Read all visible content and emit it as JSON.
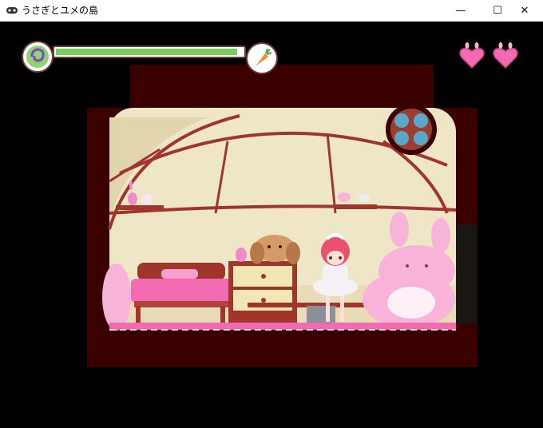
{
  "window": {
    "title": "うさぎとユメの島",
    "minimize_glyph": "—",
    "maximize_glyph": "☐",
    "close_glyph": "✕",
    "icon": "gamepad-icon"
  },
  "hud": {
    "stamina_fraction": 0.97,
    "stamina_color": "#77cc5a",
    "orb_icon": "spiral-orb-icon",
    "item_icon": "carrot-icon",
    "hearts": 2,
    "heart_icon": "bunny-heart-icon"
  },
  "scene": {
    "name": "bedroom",
    "colors": {
      "frame": "#3a0000",
      "wall": "#efe6c8",
      "floor": "#f26bb0"
    }
  }
}
